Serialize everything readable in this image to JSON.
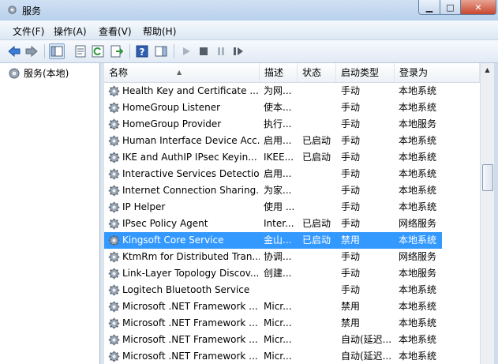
{
  "window": {
    "title": "服务"
  },
  "menu": [
    "文件(F)",
    "操作(A)",
    "查看(V)",
    "帮助(H)"
  ],
  "tree": {
    "root_label": "服务(本地)"
  },
  "columns": [
    "名称",
    "描述",
    "状态",
    "启动类型",
    "登录为"
  ],
  "rows": [
    {
      "name": "Health Key and Certificate ...",
      "desc": "为网...",
      "status": "",
      "startup": "手动",
      "logon": "本地系统"
    },
    {
      "name": "HomeGroup Listener",
      "desc": "使本...",
      "status": "",
      "startup": "手动",
      "logon": "本地系统"
    },
    {
      "name": "HomeGroup Provider",
      "desc": "执行...",
      "status": "",
      "startup": "手动",
      "logon": "本地服务"
    },
    {
      "name": "Human Interface Device Acc...",
      "desc": "启用...",
      "status": "已启动",
      "startup": "手动",
      "logon": "本地系统"
    },
    {
      "name": "IKE and AuthIP IPsec Keyin...",
      "desc": "IKEE...",
      "status": "已启动",
      "startup": "手动",
      "logon": "本地系统"
    },
    {
      "name": "Interactive Services Detection",
      "desc": "启用...",
      "status": "",
      "startup": "手动",
      "logon": "本地系统"
    },
    {
      "name": "Internet Connection Sharing...",
      "desc": "为家...",
      "status": "",
      "startup": "手动",
      "logon": "本地系统"
    },
    {
      "name": "IP Helper",
      "desc": "使用 ...",
      "status": "",
      "startup": "手动",
      "logon": "本地系统"
    },
    {
      "name": "IPsec Policy Agent",
      "desc": "Inter...",
      "status": "已启动",
      "startup": "手动",
      "logon": "网络服务"
    },
    {
      "name": "Kingsoft Core Service",
      "desc": "金山...",
      "status": "已启动",
      "startup": "禁用",
      "logon": "本地系统",
      "selected": true
    },
    {
      "name": "KtmRm for Distributed Tran...",
      "desc": "协调...",
      "status": "",
      "startup": "手动",
      "logon": "网络服务"
    },
    {
      "name": "Link-Layer Topology Discov...",
      "desc": "创建...",
      "status": "",
      "startup": "手动",
      "logon": "本地服务"
    },
    {
      "name": "Logitech Bluetooth Service",
      "desc": "",
      "status": "",
      "startup": "手动",
      "logon": "本地系统"
    },
    {
      "name": "Microsoft .NET Framework ...",
      "desc": "Micr...",
      "status": "",
      "startup": "禁用",
      "logon": "本地系统"
    },
    {
      "name": "Microsoft .NET Framework ...",
      "desc": "Micr...",
      "status": "",
      "startup": "禁用",
      "logon": "本地系统"
    },
    {
      "name": "Microsoft .NET Framework ...",
      "desc": "Micr...",
      "status": "",
      "startup": "自动(延迟...",
      "logon": "本地系统"
    },
    {
      "name": "Microsoft .NET Framework ...",
      "desc": "Micr...",
      "status": "",
      "startup": "自动(延迟...",
      "logon": "本地系统"
    }
  ],
  "colors": {
    "selection": "#3399ff",
    "titlebar": "#b9d1ec"
  }
}
